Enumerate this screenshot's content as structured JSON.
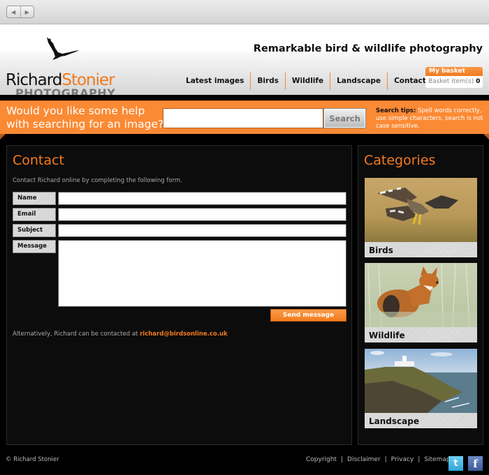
{
  "browser": {
    "back_icon": "◀",
    "forward_icon": "▶"
  },
  "header": {
    "logo_first": "Richard",
    "logo_last": "Stonier",
    "logo_sub": "PHOTOGRAPHY",
    "tagline": "Remarkable bird & wildlife photography",
    "nav": [
      {
        "label": "Latest images"
      },
      {
        "label": "Birds"
      },
      {
        "label": "Wildlife"
      },
      {
        "label": "Landscape"
      },
      {
        "label": "Contact"
      }
    ],
    "basket": {
      "title": "My basket",
      "items_label": "Basket item(s)",
      "count": "0"
    }
  },
  "search": {
    "question_line1": "Would you like some help",
    "question_line2": "with searching for an image?",
    "input_value": "",
    "button_label": "Search",
    "tips_label": "Search tips:",
    "tips_text": " Spell words correctly, use simple characters, search is not case sensitive."
  },
  "contact": {
    "heading": "Contact",
    "intro": "Contact Richard online by completing the following form.",
    "fields": [
      {
        "label": "Name",
        "value": ""
      },
      {
        "label": "Email",
        "value": ""
      },
      {
        "label": "Subject",
        "value": ""
      },
      {
        "label": "Message",
        "value": ""
      }
    ],
    "send_label": "Send message",
    "alt_text": "Alternatively, Richard can be contacted at ",
    "email": "richard@birdsonline.co.uk"
  },
  "sidebar": {
    "heading": "Categories",
    "categories": [
      {
        "label": "Birds"
      },
      {
        "label": "Wildlife"
      },
      {
        "label": "Landscape"
      }
    ]
  },
  "footer": {
    "copyright": "© Richard Stonier",
    "links": [
      {
        "label": "Copyright"
      },
      {
        "label": "Disclaimer"
      },
      {
        "label": "Privacy"
      },
      {
        "label": "Sitemap"
      }
    ],
    "separator": "|",
    "twitter_glyph": "t",
    "facebook_glyph": "f"
  },
  "colors": {
    "accent": "#f47b20",
    "search_band": "#fb8a34",
    "panel_bg": "#0c0c0c"
  }
}
